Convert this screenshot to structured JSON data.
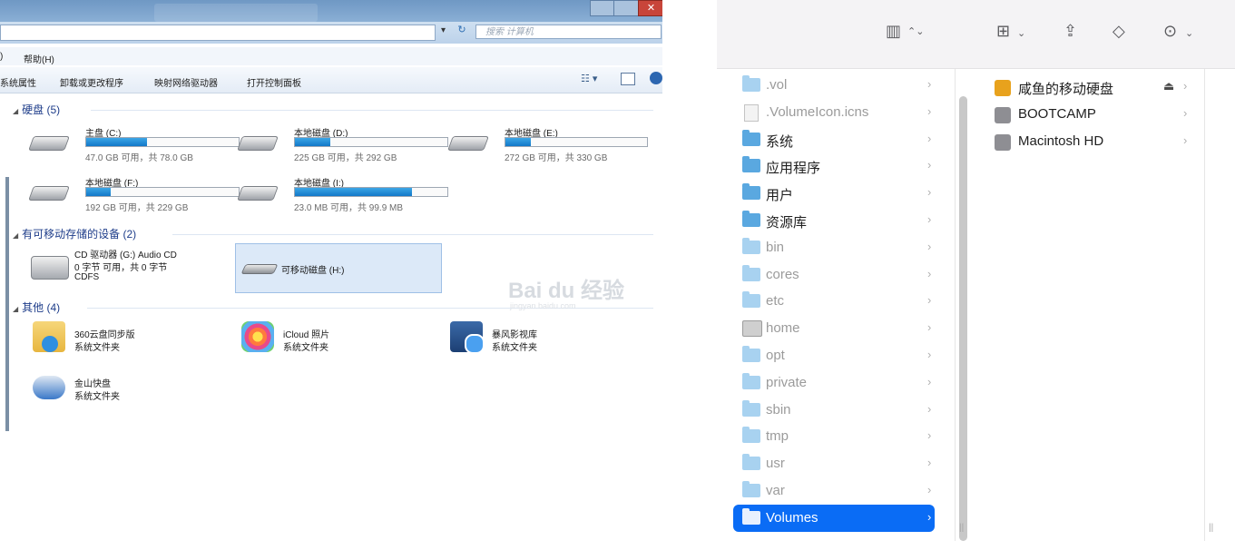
{
  "windows_explorer": {
    "menu": {
      "paren": ")",
      "help": "帮助(H)"
    },
    "search_placeholder": "搜索 计算机",
    "commands": [
      "系统属性",
      "卸载或更改程序",
      "映射网络驱动器",
      "打开控制面板"
    ],
    "sections": {
      "hard_disks": "硬盘 (5)",
      "removable": "有可移动存储的设备 (2)",
      "other": "其他 (4)"
    },
    "drives": [
      {
        "name": "主盘 (C:)",
        "size": "47.0 GB 可用，共 78.0 GB",
        "used_fraction": 0.4
      },
      {
        "name": "本地磁盘 (D:)",
        "size": "225 GB 可用，共 292 GB",
        "used_fraction": 0.23
      },
      {
        "name": "本地磁盘 (E:)",
        "size": "272 GB 可用，共 330 GB",
        "used_fraction": 0.18
      },
      {
        "name": "本地磁盘 (F:)",
        "size": "192 GB 可用，共 229 GB",
        "used_fraction": 0.16
      },
      {
        "name": "本地磁盘 (I:)",
        "size": "23.0 MB 可用，共 99.9 MB",
        "used_fraction": 0.77
      }
    ],
    "devices": {
      "cd": {
        "name": "CD 驱动器 (G:) Audio CD",
        "size": "0 字节 可用，共 0 字节",
        "fs": "CDFS"
      },
      "removable_disk": "可移动磁盘 (H:)"
    },
    "others": [
      {
        "name": "360云盘同步版",
        "type": "系统文件夹"
      },
      {
        "name": "iCloud 照片",
        "type": "系统文件夹"
      },
      {
        "name": "暴风影视库",
        "type": "系统文件夹"
      },
      {
        "name": "金山快盘",
        "type": "系统文件夹"
      }
    ],
    "watermark": {
      "brand": "Bai du 经验",
      "url": "jingyan.baidu.com"
    }
  },
  "finder": {
    "toolbar_icons": [
      "column-view-icon",
      "group-icon",
      "share-icon",
      "tag-icon",
      "more-icon"
    ],
    "column1": [
      {
        "label": ".vol",
        "dim": true,
        "icon": "folder"
      },
      {
        "label": ".VolumeIcon.icns",
        "dim": true,
        "icon": "doc"
      },
      {
        "label": "系统",
        "dim": false,
        "icon": "folder"
      },
      {
        "label": "应用程序",
        "dim": false,
        "icon": "folder"
      },
      {
        "label": "用户",
        "dim": false,
        "icon": "folder"
      },
      {
        "label": "资源库",
        "dim": false,
        "icon": "folder"
      },
      {
        "label": "bin",
        "dim": true,
        "icon": "folder"
      },
      {
        "label": "cores",
        "dim": true,
        "icon": "folder"
      },
      {
        "label": "etc",
        "dim": true,
        "icon": "folder"
      },
      {
        "label": "home",
        "dim": true,
        "icon": "home"
      },
      {
        "label": "opt",
        "dim": true,
        "icon": "folder"
      },
      {
        "label": "private",
        "dim": true,
        "icon": "folder"
      },
      {
        "label": "sbin",
        "dim": true,
        "icon": "folder"
      },
      {
        "label": "tmp",
        "dim": true,
        "icon": "folder"
      },
      {
        "label": "usr",
        "dim": true,
        "icon": "folder"
      },
      {
        "label": "var",
        "dim": true,
        "icon": "folder"
      },
      {
        "label": "Volumes",
        "dim": false,
        "icon": "folder",
        "selected": true
      }
    ],
    "volumes": [
      {
        "label": "咸鱼的移动硬盘",
        "color": "#e8a21d",
        "eject": "⏏"
      },
      {
        "label": "BOOTCAMP",
        "color": "#8e8e93"
      },
      {
        "label": "Macintosh HD",
        "color": "#8e8e93"
      }
    ],
    "colors": {
      "selection": "#0a6cf5",
      "folder": "#5aa8e0"
    }
  }
}
